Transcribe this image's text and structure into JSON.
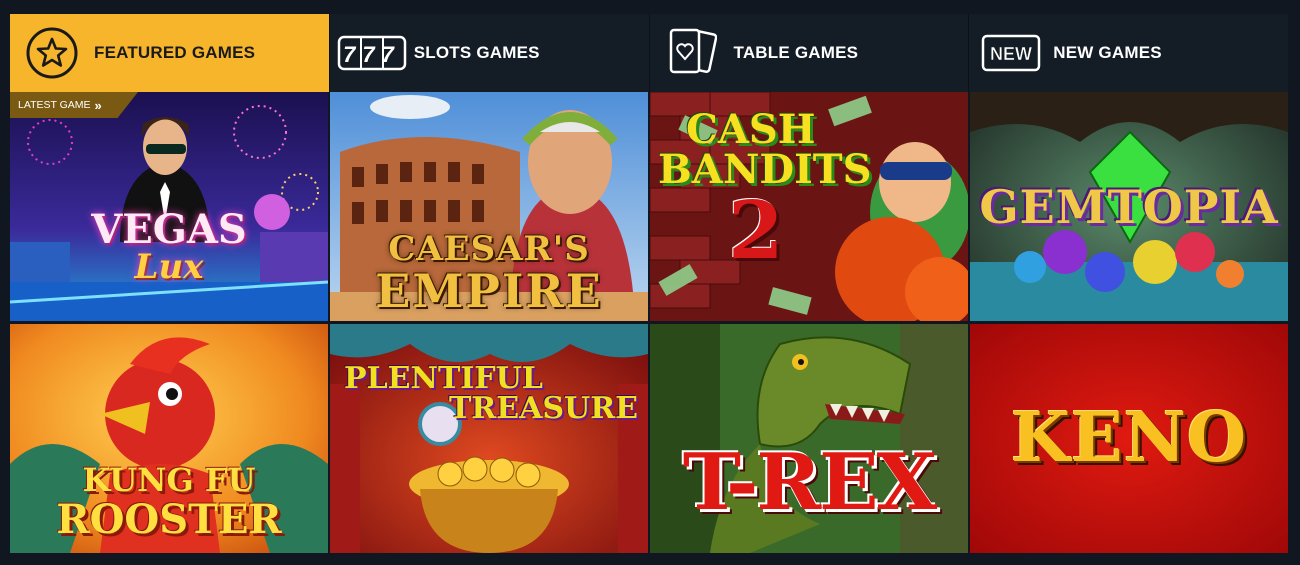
{
  "nav": {
    "tabs": [
      {
        "label": "FEATURED GAMES",
        "icon": "star-icon",
        "active": true
      },
      {
        "label": "SLOTS GAMES",
        "icon": "slots-777-icon",
        "active": false
      },
      {
        "label": "TABLE GAMES",
        "icon": "playing-cards-icon",
        "active": false
      },
      {
        "label": "NEW GAMES",
        "icon": "new-badge-icon",
        "active": false
      }
    ],
    "slots_icon_text": "777",
    "new_icon_text": "NEW"
  },
  "ribbon": {
    "text": "LATEST GAME",
    "arrow": "»"
  },
  "games": [
    {
      "line1": "VEGAS",
      "line2": "Lux"
    },
    {
      "line1": "CAESAR'S",
      "line2": "EMPIRE"
    },
    {
      "line1": "CASH",
      "line2": "BANDITS",
      "line3": "2"
    },
    {
      "line1": "GEMTOPIA"
    },
    {
      "line1": "KUNG FU",
      "line2": "ROOSTER"
    },
    {
      "line1": "PLENTIFUL",
      "line2": "TREASURE"
    },
    {
      "line1": "T-REX"
    },
    {
      "line1": "KENO"
    }
  ],
  "colors": {
    "accent": "#f7b52c",
    "tab_bg": "#141c26",
    "page_bg": "#101720"
  }
}
